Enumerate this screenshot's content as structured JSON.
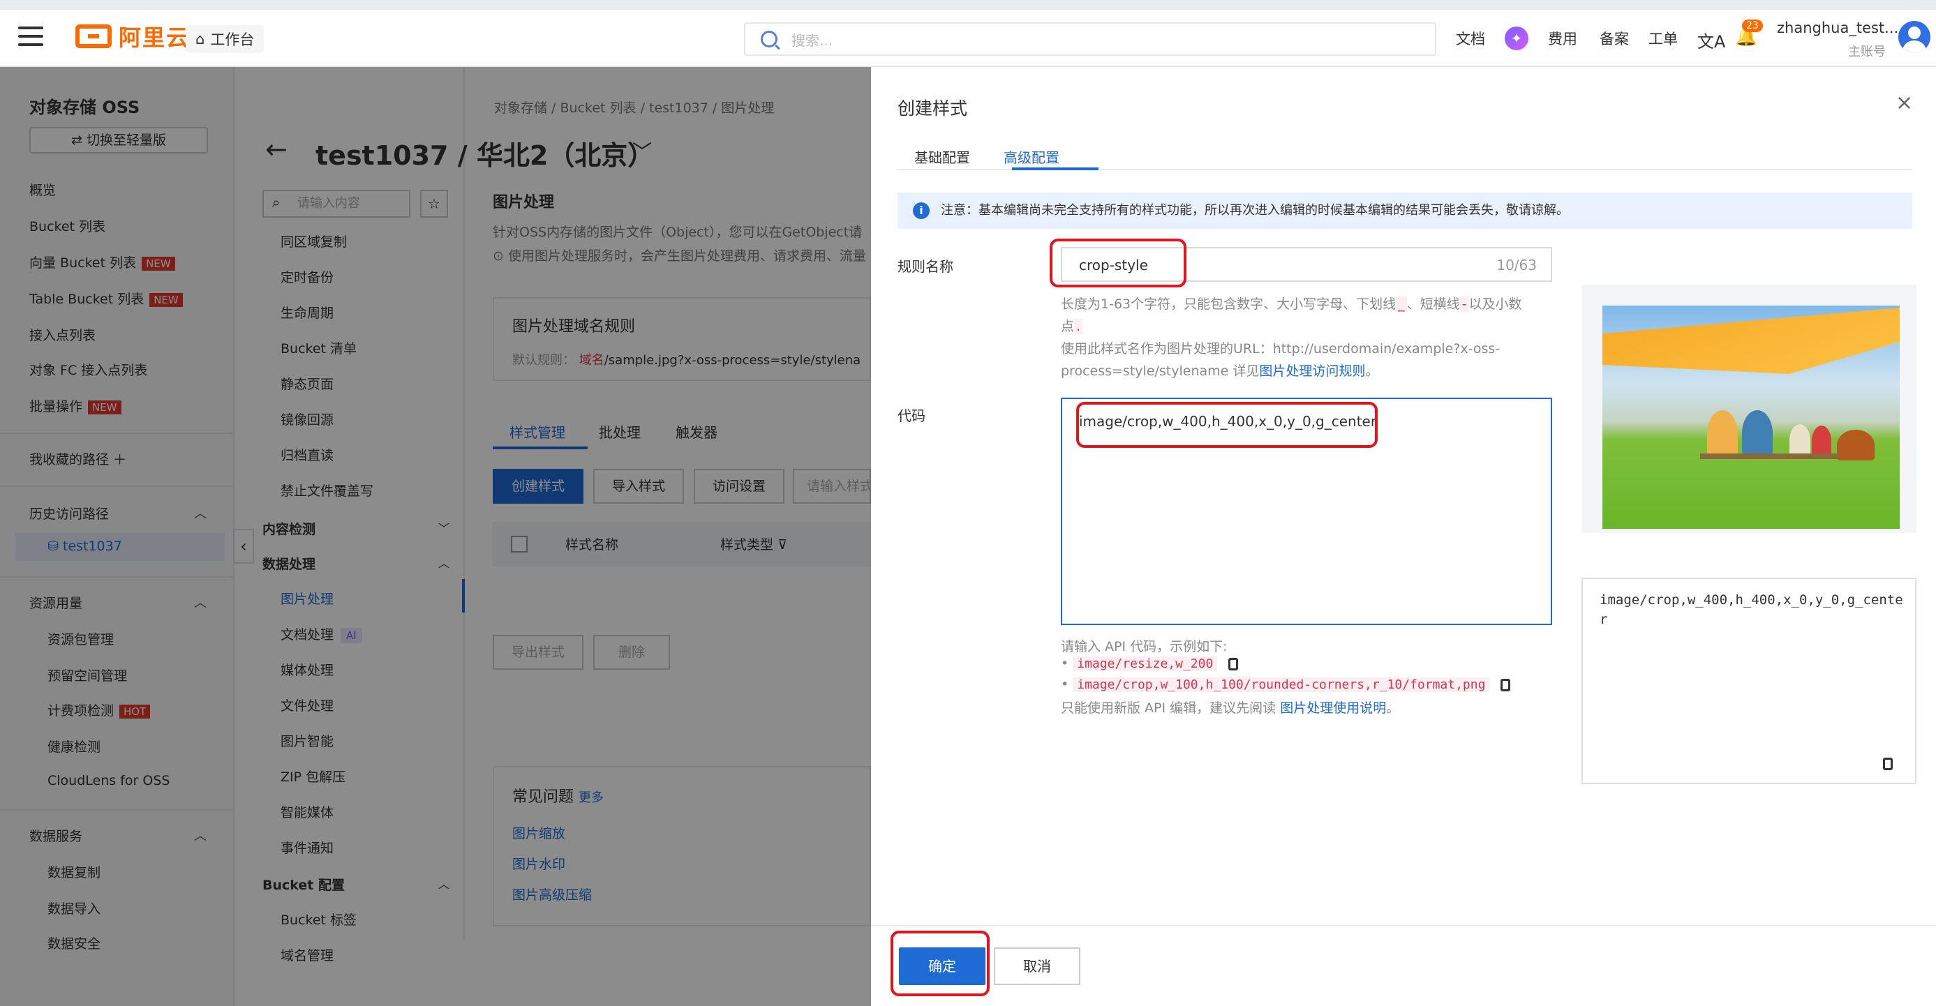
{
  "topbar": {
    "logo_text": "阿里云",
    "workbench": "工作台",
    "search_placeholder": "搜索...",
    "links": [
      "文档",
      "费用",
      "备案",
      "工单"
    ],
    "bell_count": "23",
    "user_name": "zhanghua_test...",
    "user_role": "主账号"
  },
  "sidebar": {
    "title": "对象存储 OSS",
    "switch_label": "⇄ 切换至轻量版",
    "items": [
      "概览",
      "Bucket 列表",
      "向量 Bucket 列表",
      "Table Bucket 列表",
      "接入点列表",
      "对象 FC 接入点列表",
      "批量操作"
    ],
    "new_badge": "NEW",
    "favorites": "我收藏的路径",
    "history": "历史访问路径",
    "history_item": "test1037",
    "resource": "资源用量",
    "resource_items": [
      "资源包管理",
      "预留空间管理",
      "计费项检测",
      "健康检测",
      "CloudLens for OSS"
    ],
    "hot_badge": "HOT",
    "data_service": "数据服务",
    "data_service_items": [
      "数据复制",
      "数据导入",
      "数据安全"
    ]
  },
  "midnav": {
    "search_placeholder": "请输入内容",
    "items1": [
      "同区域复制",
      "定时备份",
      "生命周期",
      "Bucket 清单",
      "静态页面",
      "镜像回源",
      "归档直读",
      "禁止文件覆盖写"
    ],
    "content_check": "内容检测",
    "data_processing": "数据处理",
    "items2": [
      "图片处理",
      "文档处理",
      "媒体处理",
      "文件处理",
      "图片智能",
      "ZIP 包解压",
      "智能媒体",
      "事件通知"
    ],
    "ai_badge": "AI",
    "bucket_config": "Bucket 配置",
    "items3": [
      "Bucket 标签",
      "域名管理"
    ]
  },
  "main": {
    "breadcrumb": [
      "对象存储",
      "Bucket 列表",
      "test1037",
      "图片处理"
    ],
    "title": "test1037 / 华北2（北京）",
    "section_title": "图片处理",
    "desc1": "针对OSS内存储的图片文件（Object），您可以在GetObject请",
    "desc2": "使用图片处理服务时，会产生图片处理费用、请求费用、流量",
    "domain_rule": "图片处理域名规则",
    "default_rule_label": "默认规则：",
    "default_rule_domain": "域名",
    "default_rule_path": "/sample.jpg?x-oss-process=style/stylena",
    "tabs": [
      "样式管理",
      "批处理",
      "触发器"
    ],
    "create_style": "创建样式",
    "import_style": "导入样式",
    "access_settings": "访问设置",
    "search_style": "请输入样式",
    "col_name": "样式名称",
    "col_type": "样式类型",
    "export": "导出样式",
    "delete": "删除",
    "faq_title": "常见问题",
    "faq_more": "更多",
    "faq_items": [
      "图片缩放",
      "图片水印",
      "图片高级压缩"
    ]
  },
  "drawer": {
    "title": "创建样式",
    "tabs": [
      "基础配置",
      "高级配置"
    ],
    "notice": "注意：基本编辑尚未完全支持所有的样式功能，所以再次进入编辑的时候基本编辑的结果可能会丢失，敬请谅解。",
    "rule_name_label": "规则名称",
    "rule_name_value": "crop-style",
    "rule_name_count": "10/63",
    "hint_a": "长度为1-63个字符，只能包含数字、大小写字母、下划线",
    "hint_underscore": "_",
    "hint_b": "、短横线",
    "hint_dash": "-",
    "hint_c": "以及小数",
    "hint_d": "点",
    "hint_dot": ".",
    "hint_url": "使用此样式名作为图片处理的URL：http://userdomain/example?x-oss-process=style/stylename 详见",
    "hint_url_link": "图片处理访问规则",
    "code_label": "代码",
    "code_value": "image/crop,w_400,h_400,x_0,y_0,g_center",
    "api_hint": "请输入 API 代码，示例如下:",
    "example1": "image/resize,w_200",
    "example2": "image/crop,w_100,h_100/rounded-corners,r_10/format,png",
    "api_note": "只能使用新版 API 编辑，建议先阅读",
    "api_note_link": "图片处理使用说明",
    "preview_code": "image/crop,w_400,h_400,x_0,y_0,g_center",
    "ok": "确定",
    "cancel": "取消"
  }
}
